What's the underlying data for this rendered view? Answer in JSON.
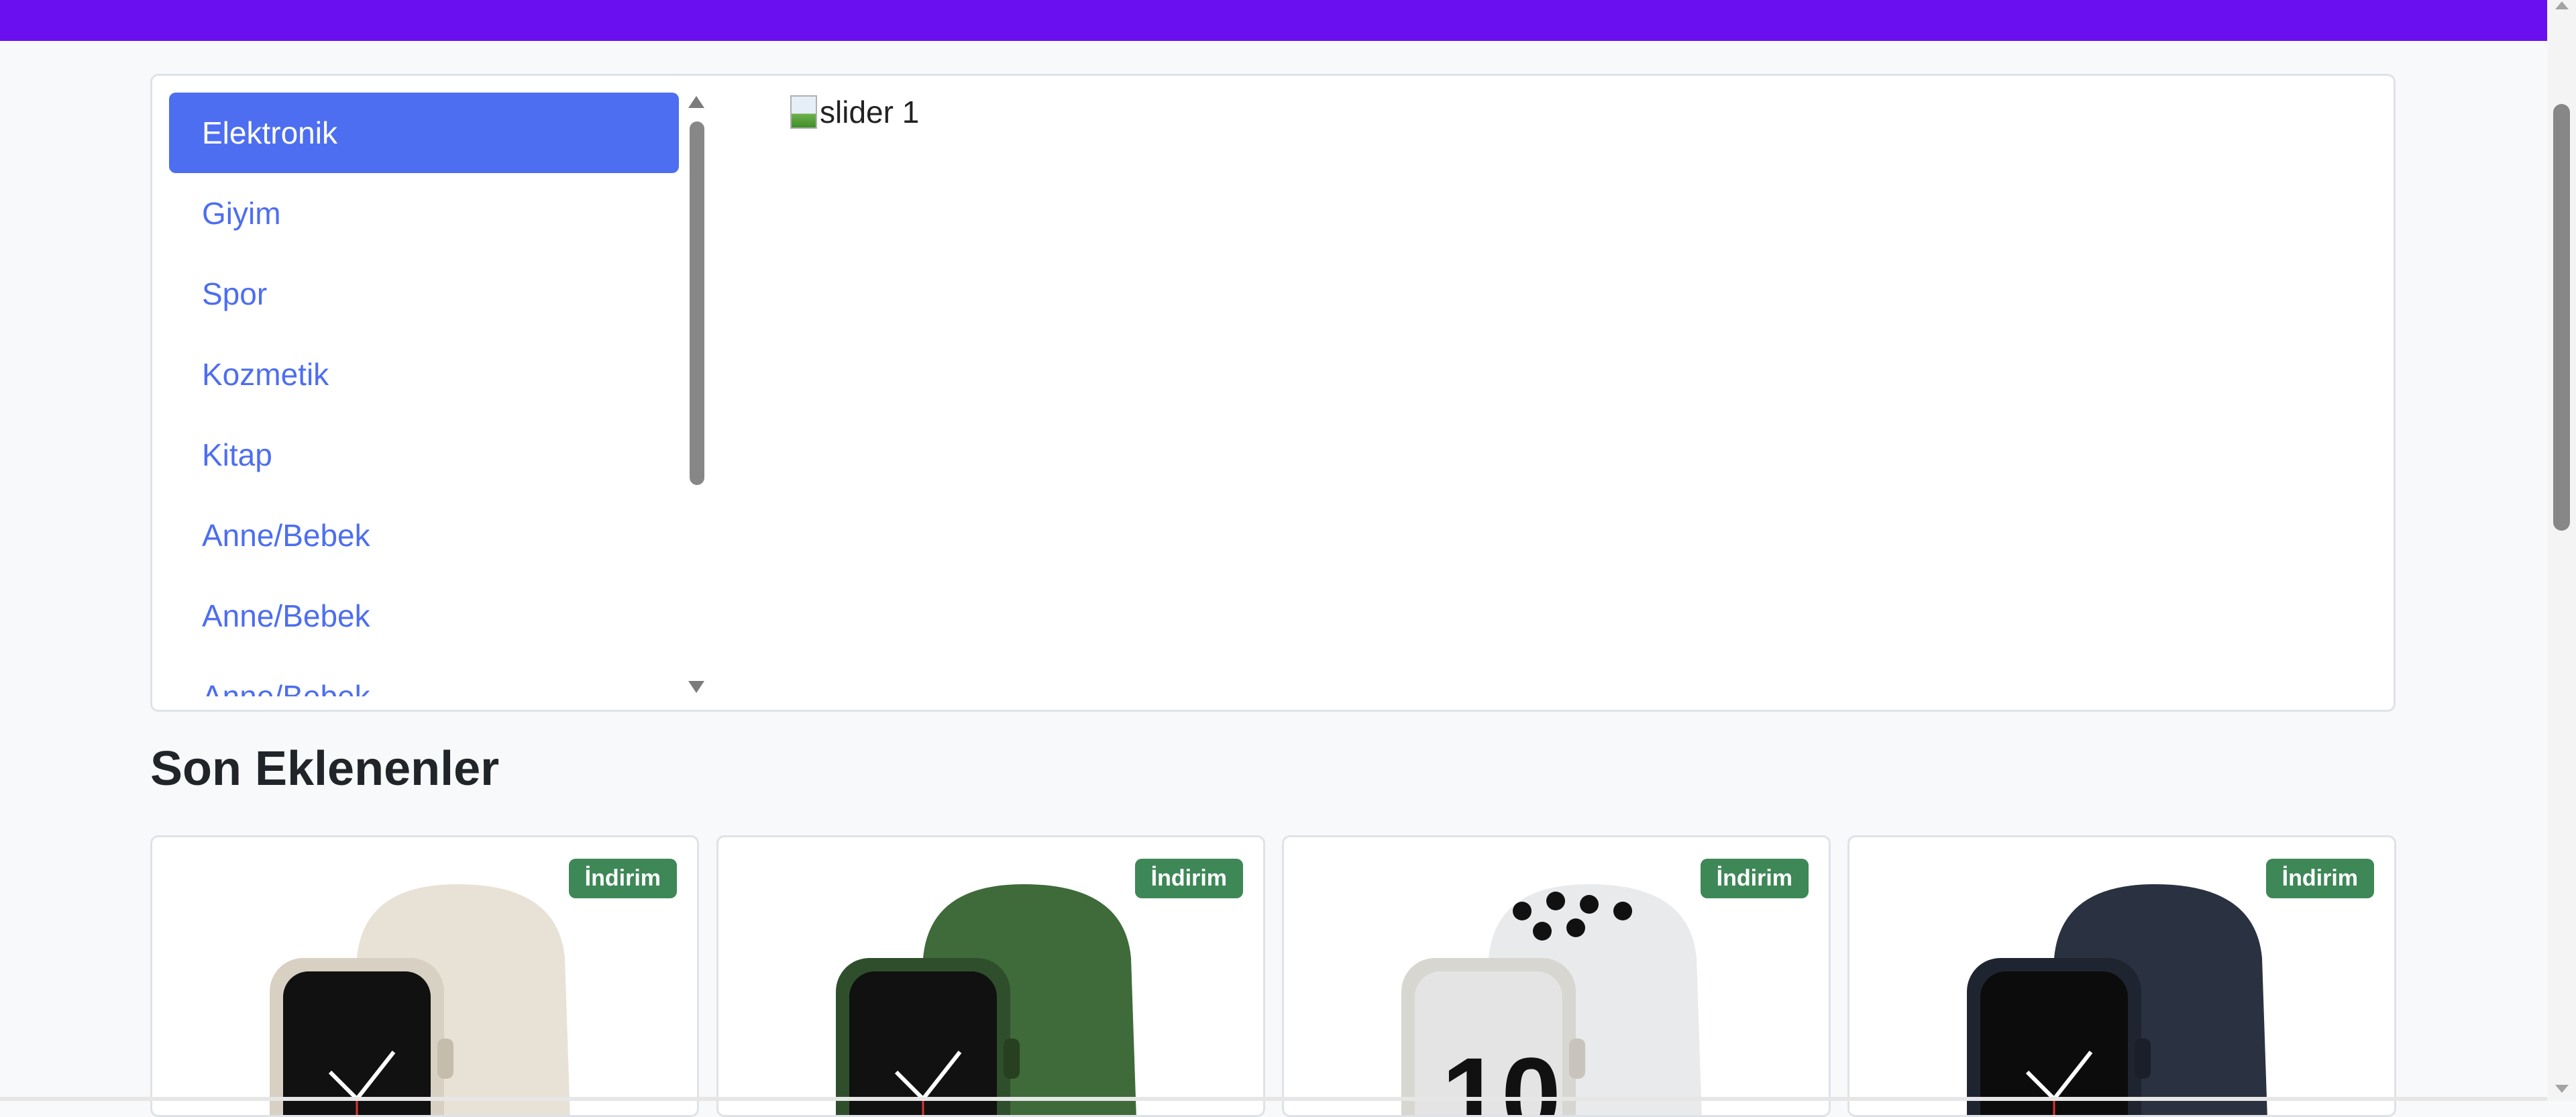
{
  "categories": [
    {
      "label": "Elektronik",
      "active": true
    },
    {
      "label": "Giyim"
    },
    {
      "label": "Spor"
    },
    {
      "label": "Kozmetik"
    },
    {
      "label": "Kitap"
    },
    {
      "label": "Anne/Bebek"
    },
    {
      "label": "Anne/Bebek"
    },
    {
      "label": "Anne/Bebek"
    }
  ],
  "slider": {
    "alt_text": "slider 1"
  },
  "section": {
    "title": "Son Eklenenler"
  },
  "products": [
    {
      "badge": "İndirim",
      "band_color": "#e8e2d6",
      "case_color": "#d8d0c2",
      "icon": "watch-starlight-icon"
    },
    {
      "badge": "İndirim",
      "band_color": "#3f6a3a",
      "case_color": "#2f4f2c",
      "icon": "watch-green-icon"
    },
    {
      "badge": "İndirim",
      "band_color": "#e9eaec",
      "case_color": "#d8d6d0",
      "icon": "watch-nike-icon"
    },
    {
      "badge": "İndirim",
      "band_color": "#2a3140",
      "case_color": "#1f2530",
      "icon": "watch-midnight-icon"
    }
  ],
  "colors": {
    "topbar": "#6a0ff0",
    "accent": "#4d6ef0",
    "badge": "#3e8757"
  }
}
